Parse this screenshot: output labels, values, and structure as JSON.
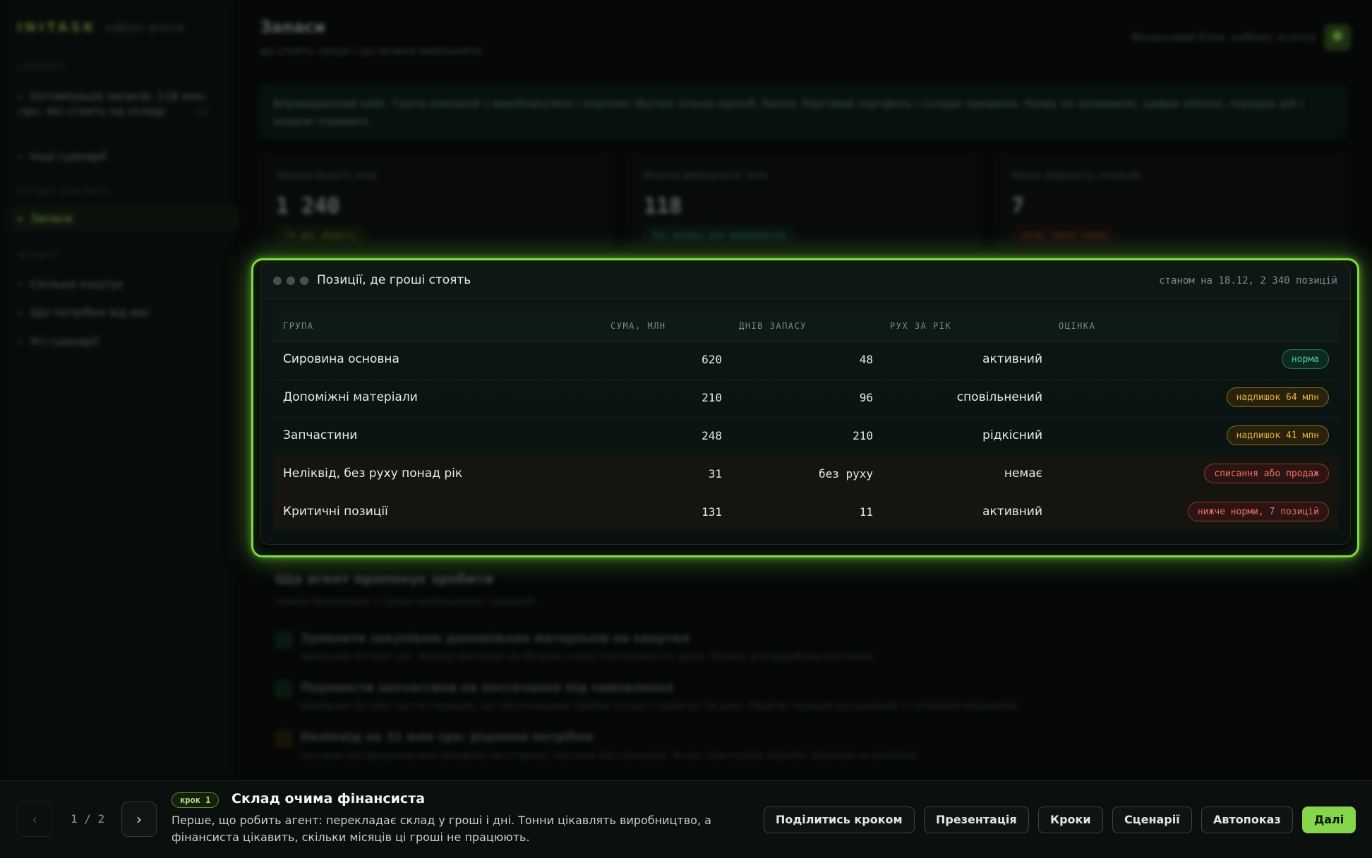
{
  "app": {
    "logo": "INITASK",
    "subtitle": "кабінет агента"
  },
  "sidebar": {
    "section1": "Сценарії",
    "scenario_active": "Оптимізація запасів: 118 млн грн, які стоять на складі",
    "scenario_active_count": "1/2",
    "scenario_other": "Інші сценарії",
    "section2": "Розділ кабінету",
    "page_active": "Запаси",
    "section3": "Вендор",
    "vendor_items": [
      "Скільки коштує",
      "Що потрібно від вас",
      "Усі сценарії"
    ]
  },
  "header": {
    "title": "Запаси",
    "subtitle": "де стоять гроші і що можна вивільнити",
    "context": "Фінансовий блок, кабінет агента"
  },
  "banner": "Впроваджений кейс. Група компаній з виробництвом і власним збутом: кілька юросіб, банки, борговий портфель і склади сировини. Назву не називаємо, цифри змінені, порядок дій і екрани справжні.",
  "kpis": [
    {
      "label": "Запаси всього, млн",
      "value": "1 240",
      "tag": "74 дні обороту",
      "tone": "#8bd04a"
    },
    {
      "label": "Можна вивільнити, млн",
      "value": "118",
      "tag": "без ризику для виробництва",
      "tone": "#3fd19c"
    },
    {
      "label": "Ризик дефіциту, позицій",
      "value": "7",
      "tag": "запас нижче норми",
      "tone": "#ef7466"
    }
  ],
  "table_card": {
    "title": "Позиції, де гроші стоять",
    "meta": "станом на 18.12, 2 340 позицій",
    "columns": [
      "ГРУПА",
      "СУМА, МЛН",
      "ДНІВ ЗАПАСУ",
      "РУХ ЗА РІК",
      "ОЦІНКА"
    ],
    "rows": [
      {
        "group": "Сировина основна",
        "sum": "620",
        "days": "48",
        "move": "активний",
        "status": "норма"
      },
      {
        "group": "Допоміжні матеріали",
        "sum": "210",
        "days": "96",
        "move": "сповільнений",
        "status": "надлишок 64 млн"
      },
      {
        "group": "Запчастини",
        "sum": "248",
        "days": "210",
        "move": "рідкісний",
        "status": "надлишок 41 млн"
      },
      {
        "group": "Неліквід, без руху понад рік",
        "sum": "31",
        "days": "без руху",
        "move": "немає",
        "status": "списання або продаж"
      },
      {
        "group": "Критичні позиції",
        "sum": "131",
        "days": "11",
        "move": "активний",
        "status": "нижче норми, 7 позицій"
      }
    ]
  },
  "proposals": {
    "title": "Що агент пропонує зробити",
    "subtitle": "кожна пропозиція з сумою вивільнення і ризиком",
    "items": [
      {
        "num": "1",
        "title": "Зупинити закупівлю допоміжних матеріалів на квартал",
        "desc": "вивільняє 64 млн грн. Запасу вистачає на 96 днів, строк постачання 21 день. Ризику для виробництва немає."
      },
      {
        "num": "2",
        "title": "Перевести запчастини на постачання під замовлення",
        "desc": "вивільняє 41 млн грн по позиціях, де постачальник тримає склад і гарантує 14 днів. Перелік позицій узгоджений з головним механіком."
      },
      {
        "num": "3",
        "title": "Неліквід на 31 млн грн: рішення потрібне",
        "desc": "частина ще придатна для продажу на сторону, частина під списання. Агент підготував перелік, рішення за комісією."
      }
    ]
  },
  "tour": {
    "pager": "1 / 2",
    "step": "крок 1",
    "title": "Склад очима фінансиста",
    "description": "Перше, що робить агент: перекладає склад у гроші і дні. Тонни цікавлять виробництво, а фінансиста цікавить, скільки місяців ці гроші не працюють.",
    "buttons": {
      "share": "Поділитись кроком",
      "presentation": "Презентація",
      "steps": "Кроки",
      "scenarios": "Сценарії",
      "autoplay": "Автопоказ",
      "next": "Далі"
    }
  }
}
